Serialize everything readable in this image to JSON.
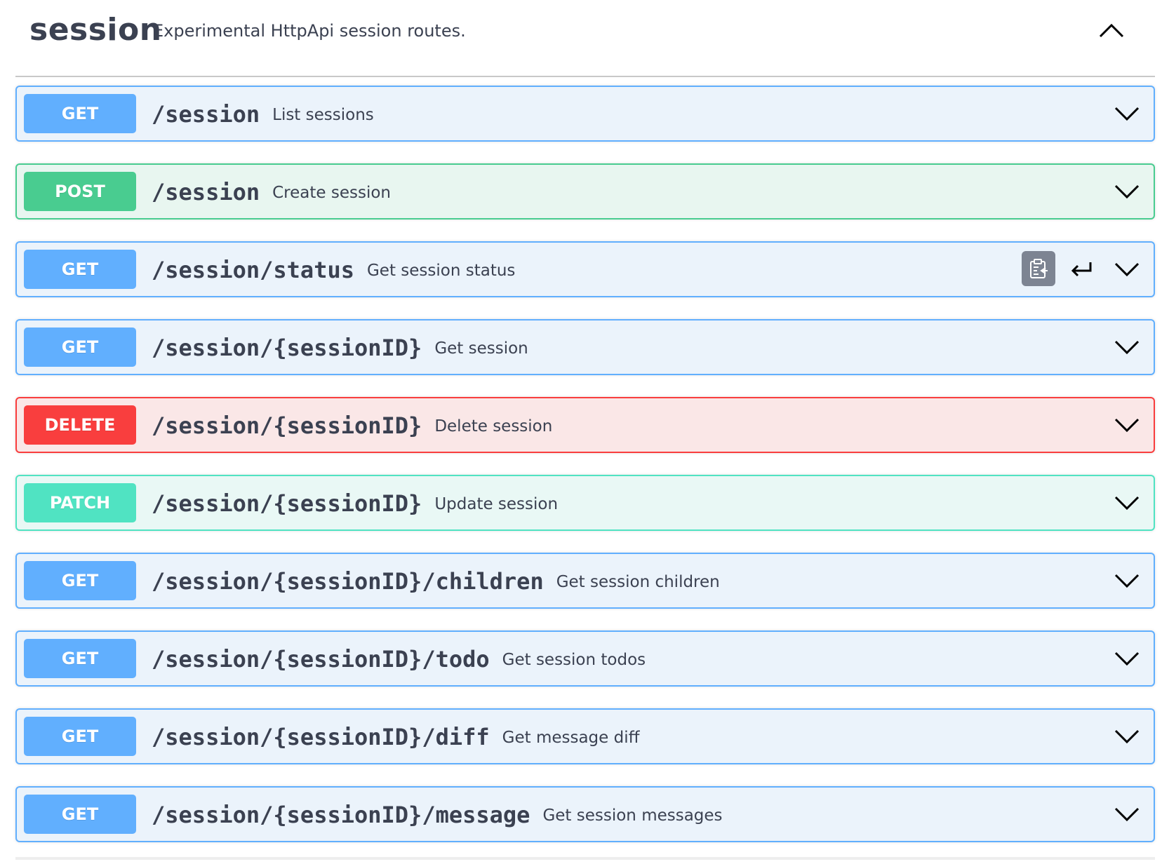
{
  "tag": {
    "name": "session",
    "description": "Experimental HttpApi session routes."
  },
  "operations": [
    {
      "method": "GET",
      "path": "/session",
      "summary": "List sessions"
    },
    {
      "method": "POST",
      "path": "/session",
      "summary": "Create session"
    },
    {
      "method": "GET",
      "path": "/session/status",
      "summary": "Get session status"
    },
    {
      "method": "GET",
      "path": "/session/{sessionID}",
      "summary": "Get session"
    },
    {
      "method": "DELETE",
      "path": "/session/{sessionID}",
      "summary": "Delete session"
    },
    {
      "method": "PATCH",
      "path": "/session/{sessionID}",
      "summary": "Update session"
    },
    {
      "method": "GET",
      "path": "/session/{sessionID}/children",
      "summary": "Get session children"
    },
    {
      "method": "GET",
      "path": "/session/{sessionID}/todo",
      "summary": "Get session todos"
    },
    {
      "method": "GET",
      "path": "/session/{sessionID}/diff",
      "summary": "Get message diff"
    },
    {
      "method": "GET",
      "path": "/session/{sessionID}/message",
      "summary": "Get session messages"
    }
  ],
  "icons": {
    "tag_toggle": "chevron-up-icon",
    "op_toggle": "chevron-down-icon",
    "copy": "clipboard-copy-icon",
    "return": "return-arrow-icon"
  },
  "colors": {
    "get": "#61affe",
    "post": "#49cc90",
    "delete": "#f93e3e",
    "patch": "#50e3c2"
  }
}
